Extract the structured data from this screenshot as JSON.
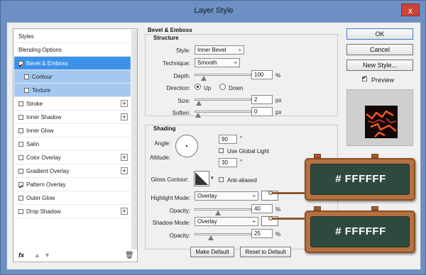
{
  "window": {
    "title": "Layer Style",
    "close": "x"
  },
  "left": {
    "items": [
      {
        "label": "Styles",
        "checkbox": false,
        "plus": false,
        "state": "header"
      },
      {
        "label": "Blending Options",
        "checkbox": false,
        "plus": false,
        "state": "normal"
      },
      {
        "label": "Bevel & Emboss",
        "checkbox": true,
        "checked": true,
        "plus": false,
        "state": "selected"
      },
      {
        "label": "Contour",
        "checkbox": true,
        "checked": false,
        "plus": false,
        "state": "sub"
      },
      {
        "label": "Texture",
        "checkbox": true,
        "checked": false,
        "plus": false,
        "state": "sub"
      },
      {
        "label": "Stroke",
        "checkbox": true,
        "checked": false,
        "plus": true
      },
      {
        "label": "Inner Shadow",
        "checkbox": true,
        "checked": false,
        "plus": true
      },
      {
        "label": "Inner Glow",
        "checkbox": true,
        "checked": false,
        "plus": false
      },
      {
        "label": "Satin",
        "checkbox": true,
        "checked": false,
        "plus": false
      },
      {
        "label": "Color Overlay",
        "checkbox": true,
        "checked": false,
        "plus": true
      },
      {
        "label": "Gradient Overlay",
        "checkbox": true,
        "checked": false,
        "plus": true
      },
      {
        "label": "Pattern Overlay",
        "checkbox": true,
        "checked": true,
        "plus": false
      },
      {
        "label": "Outer Glow",
        "checkbox": true,
        "checked": false,
        "plus": false
      },
      {
        "label": "Drop Shadow",
        "checkbox": true,
        "checked": false,
        "plus": true
      }
    ],
    "footer": {
      "fx": "fx",
      "up": "▲",
      "down": "▼",
      "trash": "🗑"
    }
  },
  "bevel": {
    "section_title": "Bevel & Emboss",
    "structure_title": "Structure",
    "style_label": "Style:",
    "style_value": "Inner Bevel",
    "technique_label": "Technique:",
    "technique_value": "Smooth",
    "depth_label": "Depth:",
    "depth_value": "100",
    "depth_unit": "%",
    "depth_level": 0.12,
    "direction_label": "Direction:",
    "up": "Up",
    "down": "Down",
    "size_label": "Size:",
    "size_value": "2",
    "size_unit": "px",
    "size_level": 0.02,
    "soften_label": "Soften:",
    "soften_value": "0",
    "soften_unit": "px",
    "soften_level": 0.0
  },
  "shading": {
    "title": "Shading",
    "angle_label": "Angle:",
    "angle_value": "90",
    "angle_unit": "°",
    "global_light": "Use Global Light",
    "altitude_label": "Altitude:",
    "altitude_value": "30",
    "altitude_unit": "°",
    "gloss_label": "Gloss Contour:",
    "anti_aliased": "Anti-aliased",
    "highlight_label": "Highlight Mode:",
    "highlight_value": "Overlay",
    "hl_opacity_label": "Opacity:",
    "hl_opacity_value": "40",
    "hl_opacity_unit": "%",
    "hl_opacity_level": 0.4,
    "shadow_label": "Shadow Mode:",
    "shadow_value": "Overlay",
    "sh_opacity_label": "Opacity:",
    "sh_opacity_value": "25",
    "sh_opacity_unit": "%",
    "sh_opacity_level": 0.25,
    "make_default": "Make Default",
    "reset_default": "Reset to Default"
  },
  "right": {
    "ok": "OK",
    "cancel": "Cancel",
    "new_style": "New Style...",
    "preview": "Preview"
  },
  "annotations": {
    "highlight_color": "# FFFFFF",
    "shadow_color": "# FFFFFF"
  }
}
